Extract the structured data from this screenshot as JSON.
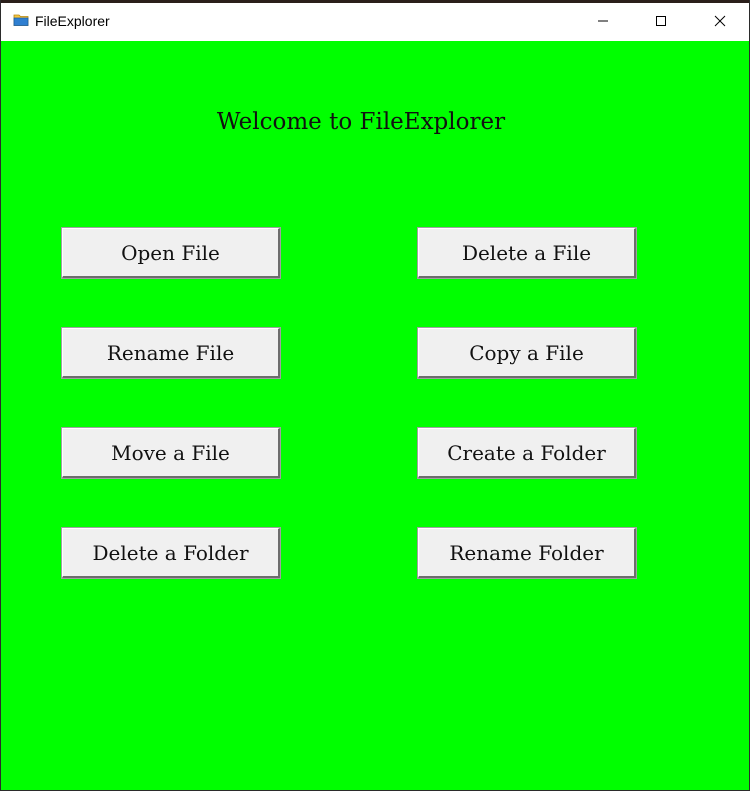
{
  "window": {
    "title": "FileExplorer",
    "app_icon": "folder-icon",
    "controls": {
      "minimize": "minimize-icon",
      "maximize": "maximize-icon",
      "close": "close-icon"
    }
  },
  "main": {
    "heading": "Welcome to FileExplorer",
    "buttons": {
      "open_file": "Open File",
      "delete_file": "Delete a File",
      "rename_file": "Rename File",
      "copy_file": "Copy a File",
      "move_file": "Move a File",
      "create_folder": "Create a Folder",
      "delete_folder": "Delete a Folder",
      "rename_folder": "Rename Folder"
    }
  },
  "colors": {
    "background": "#00ff00",
    "button_face": "#f0f0f0",
    "titlebar": "#ffffff"
  }
}
